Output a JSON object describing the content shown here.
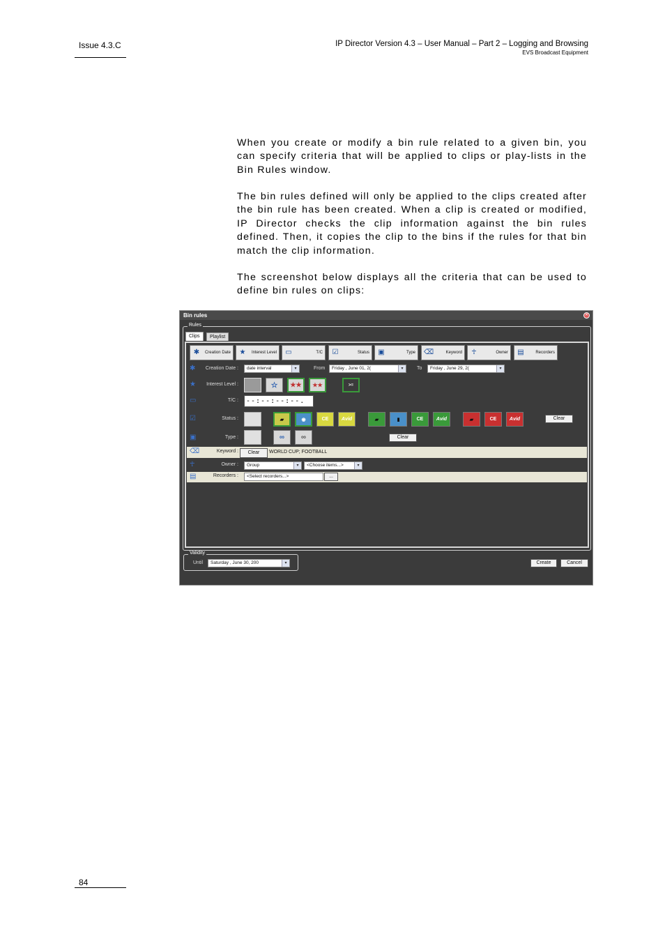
{
  "header": {
    "issue": "Issue 4.3.C",
    "title": "IP Director Version 4.3 – User Manual – Part 2 – Logging and Browsing",
    "company": "EVS Broadcast Equipment"
  },
  "paragraphs": [
    "When you create or modify a bin rule related to a given bin, you can specify criteria that will be applied to clips or play-lists in the Bin Rules window.",
    "The bin rules defined will only be applied to the clips created after the bin rule has been created. When a clip is created or modified, IP Director checks the clip information against the bin rules defined. Then, it copies the clip to the bins if the rules for that bin match the clip information.",
    "The screenshot below displays all the criteria that can be used to define bin rules on clips:"
  ],
  "dialog": {
    "title": "Bin rules",
    "rules_group": "Rules",
    "tabs": [
      "Clips",
      "Playlist"
    ],
    "criteria_buttons": [
      "Creation Date",
      "Interest Level",
      "T/C",
      "Status",
      "Type",
      "Keyword",
      "Owner",
      "Recorders"
    ],
    "rows": {
      "creation_date": {
        "label": "Creation Date :",
        "mode": "date interval",
        "from_label": "From",
        "from_value": "Friday   ,    June    01, 2(",
        "to_label": "To",
        "to_value": "Friday   ,    June    29, 2("
      },
      "interest_level": {
        "label": "Interest Level :",
        "compare": ">="
      },
      "tc": {
        "label": "T/C :",
        "value": "--:--:--:--."
      },
      "status": {
        "label": "Status :",
        "clear": "Clear",
        "ce": "CE",
        "avid": "Avid"
      },
      "type": {
        "label": "Type :",
        "clear": "Clear"
      },
      "keyword": {
        "label": "Keyword :",
        "clear": "Clear",
        "value": "WORLD CUP; FOOTBALL"
      },
      "owner": {
        "label": "Owner :",
        "value": "Group",
        "items": "<Choose items...>"
      },
      "recorders": {
        "label": "Recorders :",
        "value": "<Select recorders...>",
        "browse": "..."
      }
    },
    "validity": {
      "group": "Validity",
      "until_label": "Until",
      "until_value": "Saturday  ,    June    30, 200"
    },
    "buttons": {
      "create": "Create",
      "cancel": "Cancel"
    }
  },
  "footer": {
    "page": "84"
  }
}
